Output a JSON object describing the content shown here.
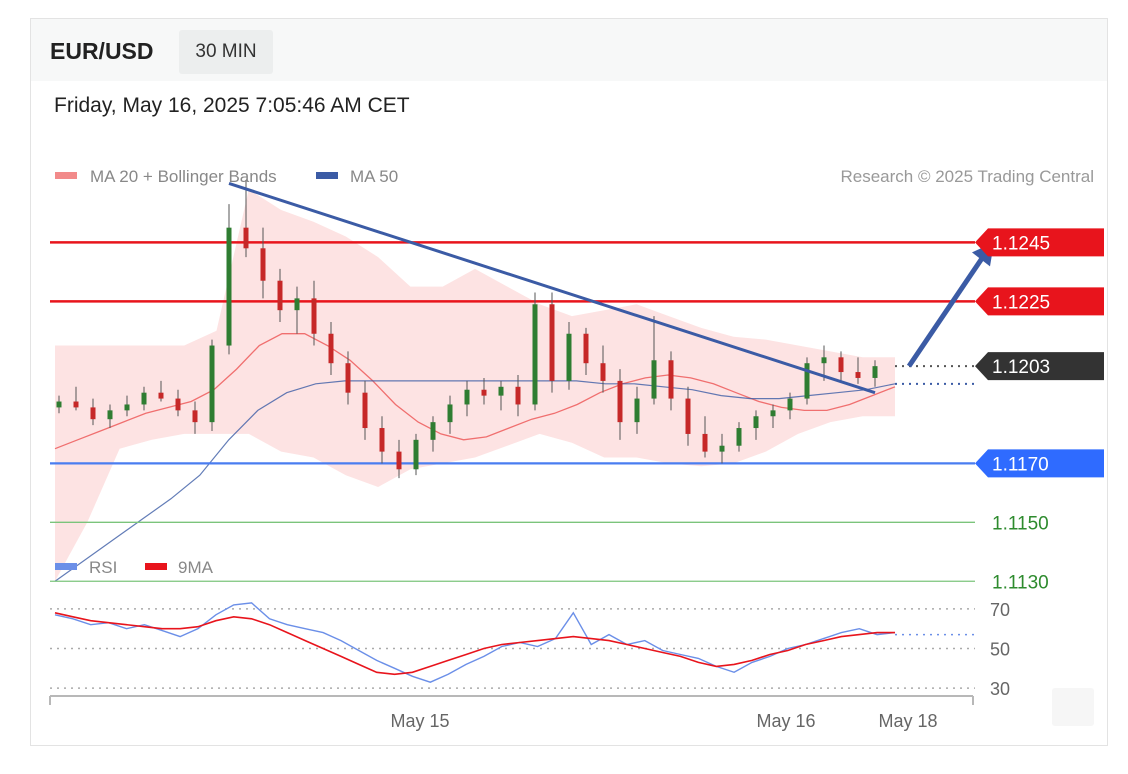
{
  "header": {
    "symbol": "EUR/USD",
    "timeframe": "30 MIN",
    "datetime": "Friday, May 16, 2025 7:05:46 AM CET"
  },
  "legend": {
    "ma20_label": "MA 20 + Bollinger Bands",
    "ma50_label": "MA 50",
    "credit": "Research © 2025 Trading Central"
  },
  "rsi_legend": {
    "rsi_label": "RSI",
    "ma_label": "9MA"
  },
  "colors": {
    "resistance": "#e8141c",
    "support": "#4a7df0",
    "green_level": "#2e8b2e",
    "current": "#333333",
    "ma20": "#f06f6f",
    "bollinger_fill": "#fde3e3",
    "ma50": "#3b5ba5",
    "trendline": "#3b5ba5",
    "candle_up": "#2f7d32",
    "candle_down": "#c62828",
    "rsi": "#6b8fe8",
    "rsi_ma": "#e8141c"
  },
  "chart_data": [
    {
      "type": "candlestick",
      "title": "EUR/USD",
      "timeframe": "30 MIN",
      "x_ticks": [
        "May 15",
        "May 16",
        "May 18"
      ],
      "ylim": [
        1.1125,
        1.1275
      ],
      "levels": [
        {
          "label": "1.1245",
          "value": 1.1245,
          "kind": "resistance"
        },
        {
          "label": "1.1225",
          "value": 1.1225,
          "kind": "resistance"
        },
        {
          "label": "1.1203",
          "value": 1.1203,
          "kind": "current"
        },
        {
          "label": "1.1170",
          "value": 1.117,
          "kind": "support"
        },
        {
          "label": "1.1150",
          "value": 1.115,
          "kind": "target"
        },
        {
          "label": "1.1130",
          "value": 1.113,
          "kind": "target"
        }
      ],
      "trendline": {
        "from": [
          10,
          1.1265
        ],
        "to": [
          48,
          1.1194
        ]
      },
      "forecast_arrow": {
        "from": [
          50,
          1.1203
        ],
        "to": [
          55,
          1.1245
        ]
      },
      "candles": [
        [
          1.1189,
          1.1193,
          1.1187,
          1.1191
        ],
        [
          1.1191,
          1.1196,
          1.1188,
          1.1189
        ],
        [
          1.1189,
          1.1192,
          1.1183,
          1.1185
        ],
        [
          1.1185,
          1.119,
          1.1182,
          1.1188
        ],
        [
          1.1188,
          1.1193,
          1.1186,
          1.119
        ],
        [
          1.119,
          1.1196,
          1.1188,
          1.1194
        ],
        [
          1.1194,
          1.1198,
          1.1191,
          1.1192
        ],
        [
          1.1192,
          1.1195,
          1.1186,
          1.1188
        ],
        [
          1.1188,
          1.1191,
          1.118,
          1.1184
        ],
        [
          1.1184,
          1.1212,
          1.1181,
          1.121
        ],
        [
          1.121,
          1.1258,
          1.1207,
          1.125
        ],
        [
          1.125,
          1.1266,
          1.124,
          1.1243
        ],
        [
          1.1243,
          1.125,
          1.1226,
          1.1232
        ],
        [
          1.1232,
          1.1236,
          1.1218,
          1.1222
        ],
        [
          1.1222,
          1.123,
          1.1214,
          1.1226
        ],
        [
          1.1226,
          1.1232,
          1.121,
          1.1214
        ],
        [
          1.1214,
          1.1218,
          1.12,
          1.1204
        ],
        [
          1.1204,
          1.1208,
          1.119,
          1.1194
        ],
        [
          1.1194,
          1.1198,
          1.1178,
          1.1182
        ],
        [
          1.1182,
          1.1186,
          1.117,
          1.1174
        ],
        [
          1.1174,
          1.1178,
          1.1165,
          1.1168
        ],
        [
          1.1168,
          1.118,
          1.1166,
          1.1178
        ],
        [
          1.1178,
          1.1186,
          1.1174,
          1.1184
        ],
        [
          1.1184,
          1.1193,
          1.118,
          1.119
        ],
        [
          1.119,
          1.1198,
          1.1186,
          1.1195
        ],
        [
          1.1195,
          1.1199,
          1.119,
          1.1193
        ],
        [
          1.1193,
          1.1198,
          1.1188,
          1.1196
        ],
        [
          1.1196,
          1.12,
          1.1186,
          1.119
        ],
        [
          1.119,
          1.1228,
          1.1188,
          1.1224
        ],
        [
          1.1224,
          1.1228,
          1.1194,
          1.1198
        ],
        [
          1.1198,
          1.1218,
          1.1195,
          1.1214
        ],
        [
          1.1214,
          1.1216,
          1.12,
          1.1204
        ],
        [
          1.1204,
          1.121,
          1.1194,
          1.1198
        ],
        [
          1.1198,
          1.1202,
          1.1178,
          1.1184
        ],
        [
          1.1184,
          1.1196,
          1.118,
          1.1192
        ],
        [
          1.1192,
          1.122,
          1.119,
          1.1205
        ],
        [
          1.1205,
          1.1208,
          1.1188,
          1.1192
        ],
        [
          1.1192,
          1.1196,
          1.1176,
          1.118
        ],
        [
          1.118,
          1.1186,
          1.1172,
          1.1174
        ],
        [
          1.1174,
          1.118,
          1.117,
          1.1176
        ],
        [
          1.1176,
          1.1184,
          1.1174,
          1.1182
        ],
        [
          1.1182,
          1.1188,
          1.1178,
          1.1186
        ],
        [
          1.1186,
          1.119,
          1.1182,
          1.1188
        ],
        [
          1.1188,
          1.1194,
          1.1185,
          1.1192
        ],
        [
          1.1192,
          1.1206,
          1.119,
          1.1204
        ],
        [
          1.1204,
          1.121,
          1.1198,
          1.1206
        ],
        [
          1.1206,
          1.1208,
          1.1198,
          1.1201
        ],
        [
          1.1201,
          1.1206,
          1.1197,
          1.1199
        ],
        [
          1.1199,
          1.1205,
          1.1196,
          1.1203
        ]
      ],
      "ma20": [
        1.1175,
        1.1178,
        1.1181,
        1.1184,
        1.1187,
        1.1189,
        1.1191,
        1.1195,
        1.1202,
        1.121,
        1.1214,
        1.1214,
        1.121,
        1.1205,
        1.1198,
        1.119,
        1.1184,
        1.118,
        1.1178,
        1.1179,
        1.1182,
        1.1185,
        1.1187,
        1.119,
        1.1194,
        1.1197,
        1.1199,
        1.12,
        1.1199,
        1.1197,
        1.1194,
        1.1191,
        1.1189,
        1.1188,
        1.1188,
        1.119,
        1.1193,
        1.1196
      ],
      "ma50": [
        1.113,
        1.1137,
        1.1144,
        1.1151,
        1.1158,
        1.1166,
        1.1178,
        1.1188,
        1.1194,
        1.1197,
        1.1198,
        1.1198,
        1.1198,
        1.1198,
        1.1198,
        1.1198,
        1.1198,
        1.1198,
        1.1198,
        1.1197,
        1.1197,
        1.1196,
        1.1195,
        1.1193,
        1.1192,
        1.1192,
        1.1193,
        1.1194,
        1.1195,
        1.1197
      ],
      "bb_upper": [
        1.121,
        1.121,
        1.121,
        1.121,
        1.121,
        1.1215,
        1.1263,
        1.1256,
        1.1252,
        1.1247,
        1.124,
        1.123,
        1.123,
        1.1236,
        1.123,
        1.1224,
        1.122,
        1.1222,
        1.1224,
        1.122,
        1.1216,
        1.1213,
        1.1212,
        1.121,
        1.1208,
        1.1206,
        1.1206
      ],
      "bb_lower": [
        1.113,
        1.115,
        1.1175,
        1.1178,
        1.118,
        1.118,
        1.118,
        1.1174,
        1.1172,
        1.1166,
        1.1162,
        1.1168,
        1.117,
        1.1172,
        1.1176,
        1.118,
        1.1177,
        1.1172,
        1.1172,
        1.117,
        1.1169,
        1.117,
        1.1174,
        1.118,
        1.1184,
        1.1186,
        1.1186
      ]
    },
    {
      "type": "line",
      "series": [
        {
          "name": "RSI",
          "values": [
            67,
            65,
            62,
            63,
            60,
            62,
            59,
            56,
            60,
            67,
            72,
            73,
            65,
            62,
            60,
            58,
            54,
            49,
            44,
            40,
            36,
            33,
            37,
            42,
            46,
            51,
            53,
            51,
            55,
            68,
            52,
            57,
            52,
            54,
            49,
            47,
            45,
            41,
            38,
            43,
            46,
            50,
            52,
            55,
            58,
            60,
            57,
            58
          ]
        },
        {
          "name": "9MA",
          "values": [
            68,
            66,
            64,
            63,
            62,
            61,
            60,
            60,
            61,
            64,
            66,
            65,
            62,
            58,
            54,
            50,
            46,
            42,
            38,
            37,
            38,
            41,
            44,
            47,
            50,
            52,
            53,
            54,
            55,
            56,
            55,
            54,
            52,
            50,
            48,
            46,
            43,
            41,
            42,
            44,
            47,
            49,
            52,
            54,
            56,
            57,
            58,
            58
          ]
        }
      ],
      "ylim": [
        20,
        80
      ],
      "y_ticks": [
        "70",
        "50",
        "30"
      ],
      "reference_lines": [
        70,
        57,
        50,
        30
      ]
    }
  ]
}
